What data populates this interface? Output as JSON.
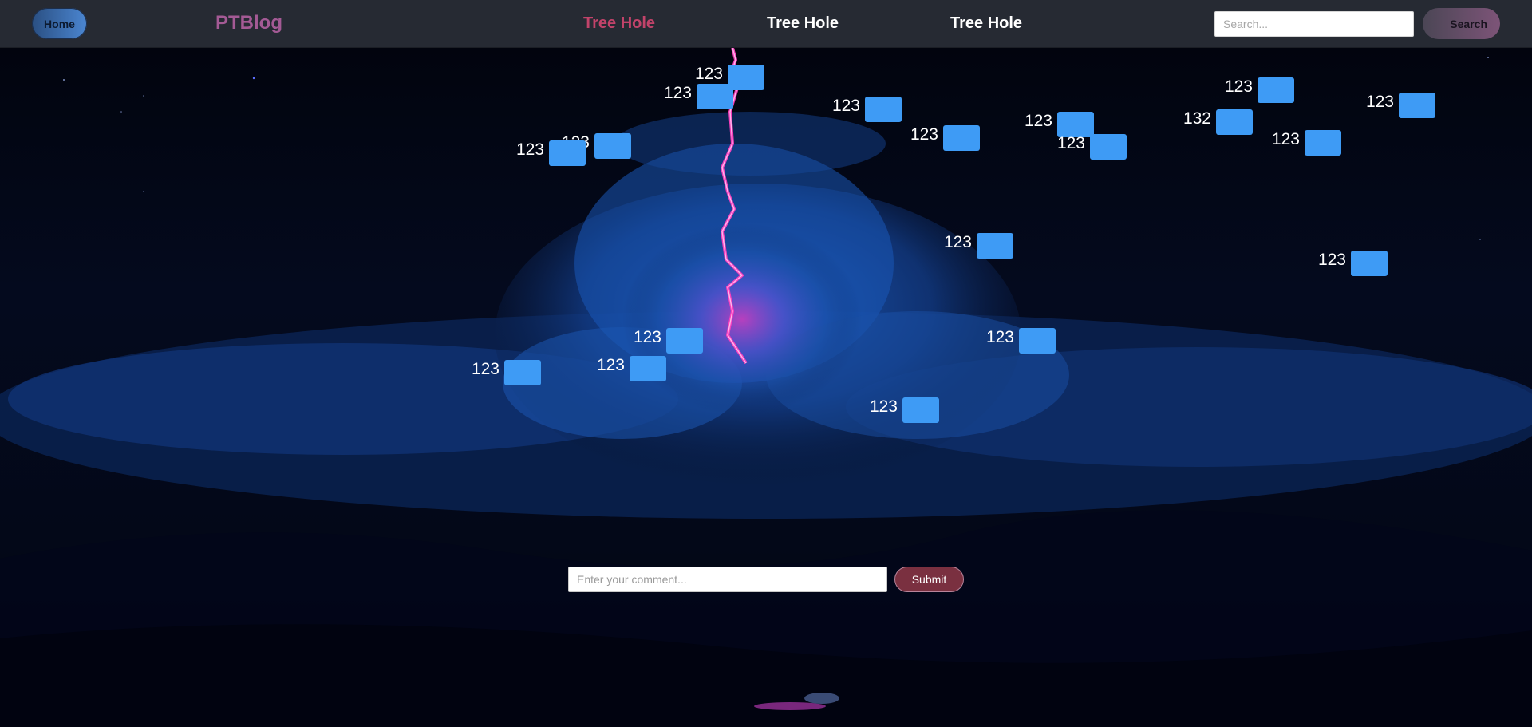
{
  "navbar": {
    "home_label": "Home",
    "brand": "PTBlog",
    "links": [
      {
        "label": "Tree Hole",
        "active": true
      },
      {
        "label": "Tree Hole",
        "active": false
      },
      {
        "label": "Tree Hole",
        "active": false
      }
    ],
    "search_placeholder": "Search...",
    "search_label": "Search"
  },
  "notes": [
    {
      "label": "123"
    },
    {
      "label": "123"
    },
    {
      "label": "123"
    },
    {
      "label": "123"
    },
    {
      "label": "123"
    },
    {
      "label": "123"
    },
    {
      "label": "123"
    },
    {
      "label": "123"
    },
    {
      "label": "123"
    },
    {
      "label": "132"
    },
    {
      "label": "123"
    },
    {
      "label": "123"
    },
    {
      "label": "123"
    },
    {
      "label": "123"
    },
    {
      "label": "123"
    },
    {
      "label": "123"
    },
    {
      "label": "123"
    },
    {
      "label": "123"
    },
    {
      "label": "123"
    }
  ],
  "comment_form": {
    "placeholder": "Enter your comment...",
    "submit_label": "Submit"
  },
  "colors": {
    "navbar_bg": "#262a33",
    "note_box": "#3e9bf5",
    "brand": "#a45a95",
    "active_link": "#c2436a",
    "lightning": "#e0309e"
  },
  "background_icon": "lightning-storm-cloud-illustration"
}
